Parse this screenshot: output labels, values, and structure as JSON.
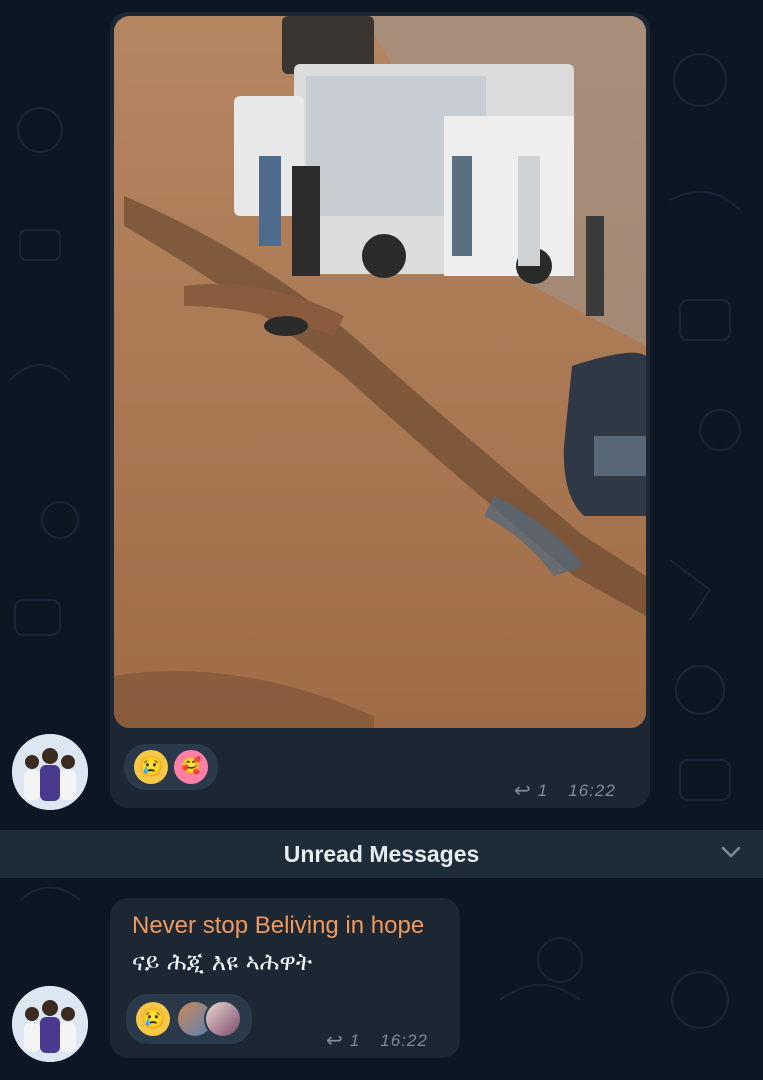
{
  "messages": [
    {
      "type": "photo",
      "reactions": [
        "😢",
        "🥰"
      ],
      "forward_count": "1",
      "time": "16:22"
    },
    {
      "type": "text",
      "sender": "Never stop Beliving in hope",
      "text": "ናይ ሕጂ እዩ ኣሕዋት",
      "reactions": [
        "😢"
      ],
      "forward_count": "1",
      "time": "16:22"
    }
  ],
  "unread_divider": "Unread Messages",
  "colors": {
    "background": "#0e1621",
    "bubble": "#1c2733",
    "sender_name": "#ef9a5b",
    "divider": "#1e2c3a"
  },
  "icons": {
    "forward": "reply-arrow-icon",
    "scroll_down": "chevron-down-icon"
  }
}
